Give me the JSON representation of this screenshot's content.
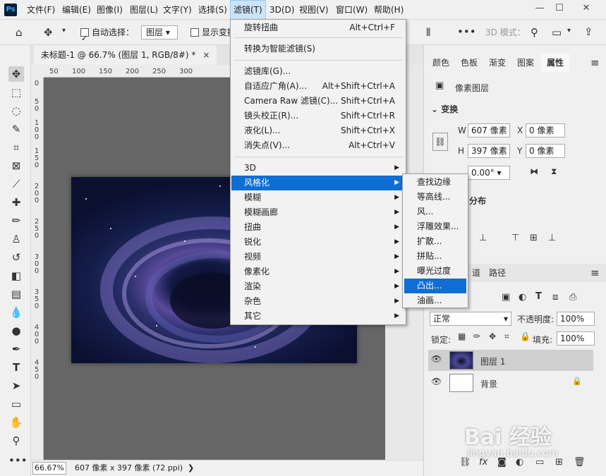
{
  "app": {
    "logo": "Ps"
  },
  "menubar": [
    "文件(F)",
    "编辑(E)",
    "图像(I)",
    "图层(L)",
    "文字(Y)",
    "选择(S)",
    "滤镜(T)",
    "3D(D)",
    "视图(V)",
    "窗口(W)",
    "帮助(H)"
  ],
  "window_controls": {
    "minimize": "—",
    "maximize": "☐",
    "close": "✕"
  },
  "options": {
    "auto_select_label": "自动选择：",
    "auto_select_value": "图层",
    "show_transform_label": "显示变换",
    "mode_3d_label": "3D 模式："
  },
  "document": {
    "tab_title": "未标题-1 @ 66.7% (图层 1, RGB/8#) *",
    "close": "×"
  },
  "ruler_top": [
    "50",
    "100",
    "150",
    "200",
    "250",
    "300"
  ],
  "ruler_left": [
    "0",
    "5",
    "0",
    "1",
    "0",
    "0",
    "1",
    "5",
    "0",
    "2",
    "0",
    "0",
    "2",
    "5",
    "0",
    "3",
    "0",
    "0",
    "3",
    "5",
    "0",
    "4",
    "0",
    "0",
    "4",
    "5",
    "0"
  ],
  "status": {
    "zoom": "66.67%",
    "info": "607 像素 x 397 像素 (72 ppi)",
    "arrow": "❯"
  },
  "filter_menu": {
    "section1": [
      {
        "label": "旋转扭曲",
        "shortcut": "Alt+Ctrl+F"
      }
    ],
    "section2": [
      {
        "label": "转换为智能滤镜(S)",
        "shortcut": ""
      }
    ],
    "section3": [
      {
        "label": "滤镜库(G)...",
        "shortcut": ""
      },
      {
        "label": "自适应广角(A)...",
        "shortcut": "Alt+Shift+Ctrl+A"
      },
      {
        "label": "Camera Raw 滤镜(C)...",
        "shortcut": "Shift+Ctrl+A"
      },
      {
        "label": "镜头校正(R)...",
        "shortcut": "Shift+Ctrl+R"
      },
      {
        "label": "液化(L)...",
        "shortcut": "Shift+Ctrl+X"
      },
      {
        "label": "消失点(V)...",
        "shortcut": "Alt+Ctrl+V"
      }
    ],
    "section4": [
      "3D",
      "风格化",
      "模糊",
      "模糊画廊",
      "扭曲",
      "锐化",
      "视频",
      "像素化",
      "渲染",
      "杂色",
      "其它"
    ]
  },
  "stylize_menu": [
    "查找边缘",
    "等高线...",
    "风...",
    "浮雕效果...",
    "扩散...",
    "拼贴...",
    "曝光过度",
    "凸出...",
    "油画..."
  ],
  "panels": {
    "tabs": [
      "颜色",
      "色板",
      "渐变",
      "图案",
      "属性"
    ],
    "pixel_layer": "像素图层",
    "transform_title": "变换",
    "w_label": "W",
    "w_value": "607 像素",
    "x_label": "X",
    "x_value": "0 像素",
    "h_label": "H",
    "h_value": "397 像素",
    "y_label": "Y",
    "y_value": "0 像素",
    "angle": "0.00°",
    "distribute_partial": "分布",
    "layers_tabs_partial": "道",
    "paths_tab": "路径",
    "blend_mode": "正常",
    "opacity_label": "不透明度:",
    "opacity_value": "100%",
    "lock_label": "锁定:",
    "fill_label": "填充:",
    "fill_value": "100%",
    "layers": [
      {
        "name": "图层 1"
      },
      {
        "name": "背景"
      }
    ]
  },
  "watermark": {
    "brand": "Bai 经验",
    "url": "jingyan.baidu.com"
  },
  "colors": {
    "menu_highlight": "#0f6ed3",
    "canvas_bg": "#666666",
    "chrome": "#f0f0f0"
  }
}
